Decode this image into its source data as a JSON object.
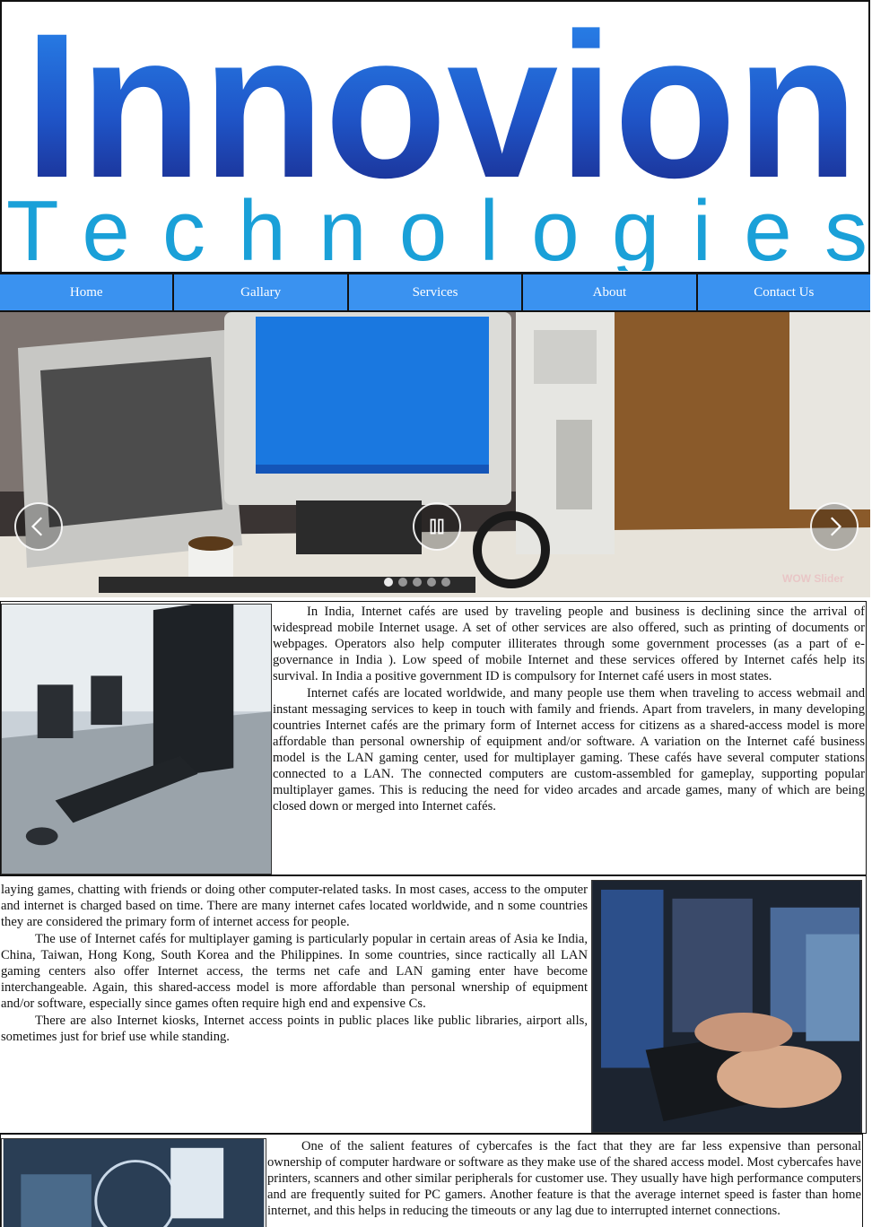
{
  "brand": {
    "line1": "Innovion",
    "line2": "Technologies",
    "colors": {
      "blue_dark": "#1a2a8c",
      "blue_light": "#2f7fe0",
      "teal": "#1aa0d8"
    }
  },
  "nav": {
    "items": [
      "Home",
      "Gallary",
      "Services",
      "About",
      "Contact Us"
    ],
    "color": "#3a92f0"
  },
  "slider": {
    "watermark": "WOW Slider",
    "prev_icon": "chevron-left-icon",
    "pause_icon": "pause-icon",
    "next_icon": "chevron-right-icon"
  },
  "sections": {
    "s1": [
      "In India, Internet cafés are used by traveling people and business is declining since the arrival of widespread mobile Internet usage. A set of other services are also offered, such as printing of documents or webpages. Operators also help computer illiterates through some government processes (as a part of e-governance in India ). Low speed of mobile Internet and these services offered by Internet cafés help its survival. In India a positive government ID is compulsory for Internet café users in most states.",
      "Internet cafés are located worldwide, and many people use them when traveling to access webmail and instant messaging services to keep in touch with family and friends. Apart from travelers, in many developing countries Internet cafés are the primary form of Internet access for citizens as a shared-access model is more affordable than personal ownership of equipment and/or software. A variation on the Internet café business model is the LAN gaming center, used for multiplayer gaming. These cafés have several computer stations connected to a LAN. The connected computers are custom-assembled for gameplay, supporting popular multiplayer games. This is reducing the need for video arcades and arcade games, many of which are being closed down or merged into Internet cafés."
    ],
    "s2": [
      "laying games, chatting with friends or doing other computer-related tasks. In most cases, access to the omputer and internet is charged based on time. There are many internet cafes located worldwide, and n some countries they are considered the primary form of internet access for people.",
      "The use of Internet cafés for multiplayer gaming is particularly popular in certain areas of Asia ke India, China, Taiwan, Hong Kong, South Korea and the Philippines. In some countries, since ractically all LAN gaming centers also offer Internet access, the terms net cafe and LAN gaming enter have become interchangeable. Again, this shared-access model is more affordable than personal wnership of equipment and/or software, especially since games often require high end and expensive Cs.",
      "There are also Internet kiosks, Internet access points in public places like public libraries, airport alls, sometimes just for brief use while standing."
    ],
    "s3": [
      "One of the salient features of cybercafes is the fact that they are far less expensive than personal ownership of computer hardware or software as they make use of the shared access model. Most cybercafes have printers, scanners and other similar peripherals for customer use. They usually have high performance computers and are frequently suited for PC gamers. Another feature is that the average internet speed is faster than home internet, and this helps in reducing the timeouts or any lag due to interrupted internet connections."
    ]
  }
}
